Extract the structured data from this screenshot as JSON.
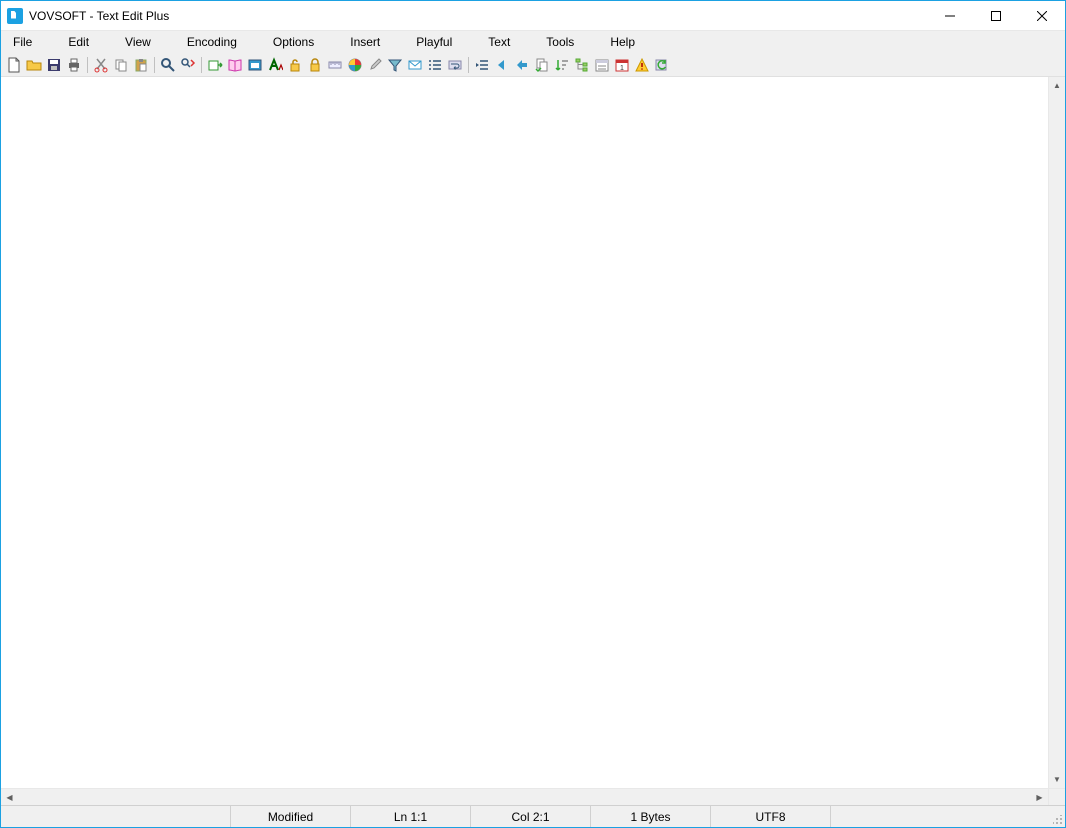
{
  "window": {
    "title": "VOVSOFT - Text Edit Plus"
  },
  "menu": {
    "items": [
      "File",
      "Edit",
      "View",
      "Encoding",
      "Options",
      "Insert",
      "Playful",
      "Text",
      "Tools",
      "Help"
    ]
  },
  "toolbar": {
    "icons": [
      "new-file-icon",
      "open-file-icon",
      "save-icon",
      "print-icon",
      "|",
      "cut-icon",
      "copy-icon",
      "paste-icon",
      "|",
      "find-icon",
      "find-replace-icon",
      "|",
      "export-icon",
      "read-mode-icon",
      "fullscreen-icon",
      "font-icon",
      "lock-open-icon",
      "lock-icon",
      "ruler-icon",
      "color-wheel-icon",
      "eyedropper-icon",
      "filter-icon",
      "mail-icon",
      "list-icon",
      "wrap-icon",
      "|",
      "indent-icon",
      "prev-icon",
      "next-icon",
      "copy-doc-icon",
      "sort-icon",
      "tree-icon",
      "calendar-list-icon",
      "date-icon",
      "warning-icon",
      "refresh-icon"
    ]
  },
  "editor": {
    "content": ""
  },
  "status": {
    "modified": "Modified",
    "line": "Ln 1:1",
    "col": "Col 2:1",
    "size": "1 Bytes",
    "encoding": "UTF8"
  }
}
